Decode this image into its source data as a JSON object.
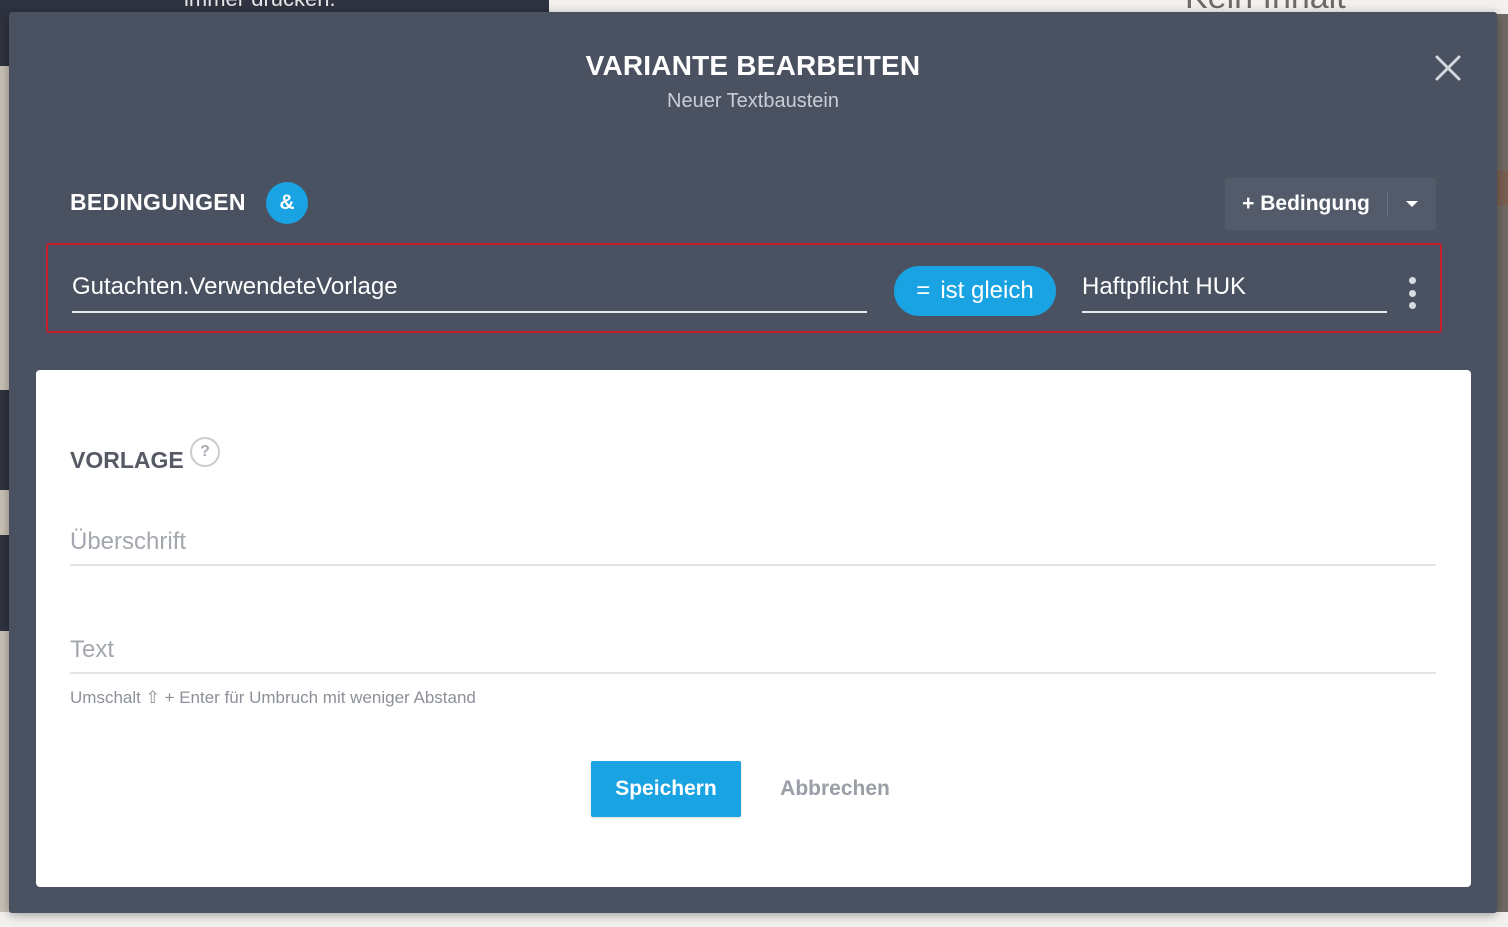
{
  "background": {
    "left_text": "immer drucken.",
    "right_text": "Kein Inhalt vorhanden"
  },
  "modal": {
    "title": "VARIANTE BEARBEITEN",
    "subtitle": "Neuer Textbaustein",
    "close_icon": "close-icon"
  },
  "conditions": {
    "heading": "BEDINGUNGEN",
    "logic_badge": "&",
    "add_button_label": "+ Bedingung",
    "rows": [
      {
        "field": "Gutachten.VerwendeteVorlage",
        "operator_symbol": "=",
        "operator_label": "ist gleich",
        "value": "Haftpflicht HUK"
      }
    ]
  },
  "template": {
    "heading": "VORLAGE",
    "help_label": "?",
    "heading_placeholder": "Überschrift",
    "text_placeholder": "Text",
    "hint": "Umschalt ⇧ + Enter für Umbruch mit weniger Abstand"
  },
  "actions": {
    "save": "Speichern",
    "cancel": "Abbrechen"
  },
  "colors": {
    "modal_bg": "#4a5160",
    "accent": "#1aa3e3",
    "error_border": "#c7202c"
  }
}
